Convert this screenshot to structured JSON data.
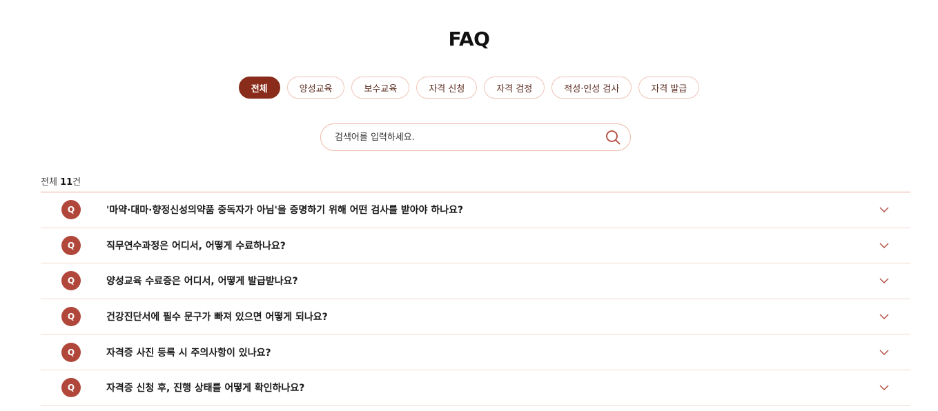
{
  "title": "FAQ",
  "tabs": [
    {
      "label": "전체",
      "active": true
    },
    {
      "label": "양성교육",
      "active": false
    },
    {
      "label": "보수교육",
      "active": false
    },
    {
      "label": "자격 신청",
      "active": false
    },
    {
      "label": "자격 검정",
      "active": false
    },
    {
      "label": "적성·인성 검사",
      "active": false
    },
    {
      "label": "자격 발급",
      "active": false
    }
  ],
  "search": {
    "placeholder": "검색어를 입력하세요.",
    "value": "",
    "icon": "search-icon"
  },
  "count": {
    "prefix": "전체 ",
    "number": "11",
    "suffix": "건"
  },
  "faq": {
    "badge": "Q",
    "items": [
      "'마약·대마·향정신성의약품 중독자가 아님'을 증명하기 위해 어떤 검사를 받아야 하나요?",
      "직무연수과정은 어디서, 어떻게 수료하나요?",
      "양성교육 수료증은 어디서, 어떻게 발급받나요?",
      "건강진단서에 필수 문구가 빠져 있으면 어떻게 되나요?",
      "자격증 사진 등록 시 주의사항이 있나요?",
      "자격증 신청 후, 진행 상태를 어떻게 확인하나요?"
    ]
  },
  "colors": {
    "accent": "#8a2c1b",
    "badge": "#b0473a",
    "border": "#efc5b8"
  }
}
